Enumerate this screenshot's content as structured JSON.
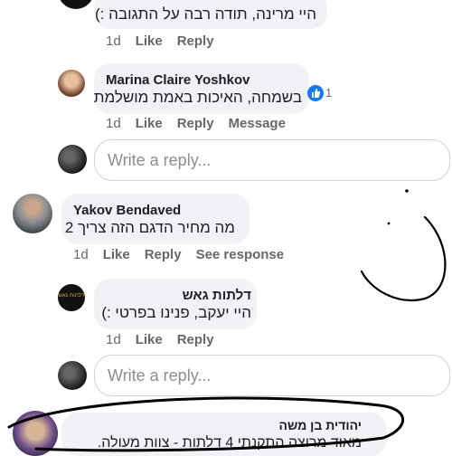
{
  "comments": [
    {
      "text": "היי מרינה, תודה רבה על התגובה :)",
      "time": "1d",
      "like": "Like",
      "reply": "Reply"
    },
    {
      "author": "Marina Claire Yoshkov",
      "text": "בשמחה, האיכות באמת מושלמת",
      "reaction_count": "1",
      "time": "1d",
      "like": "Like",
      "reply": "Reply",
      "message": "Message"
    },
    {
      "author": "Yakov Bendaved",
      "text": "מה מחיר הדגם הזה צריך 2",
      "time": "1d",
      "like": "Like",
      "reply": "Reply",
      "see_response": "See response"
    },
    {
      "author": "דלתות גאש",
      "text": "היי יעקב, פנינו בפרטי :)",
      "time": "1d",
      "like": "Like",
      "reply": "Reply"
    },
    {
      "author": "יהודית בן משה",
      "text": "מאוד מרוצה התקנתי 4 דלתות - צוות מעולה."
    }
  ],
  "reply_box": {
    "placeholder": "Write a reply..."
  },
  "logo_text": "דלתות גאש",
  "colors": {
    "bubble": "#f0f2f5",
    "like_blue": "#1877f2",
    "meta": "#65676b"
  }
}
